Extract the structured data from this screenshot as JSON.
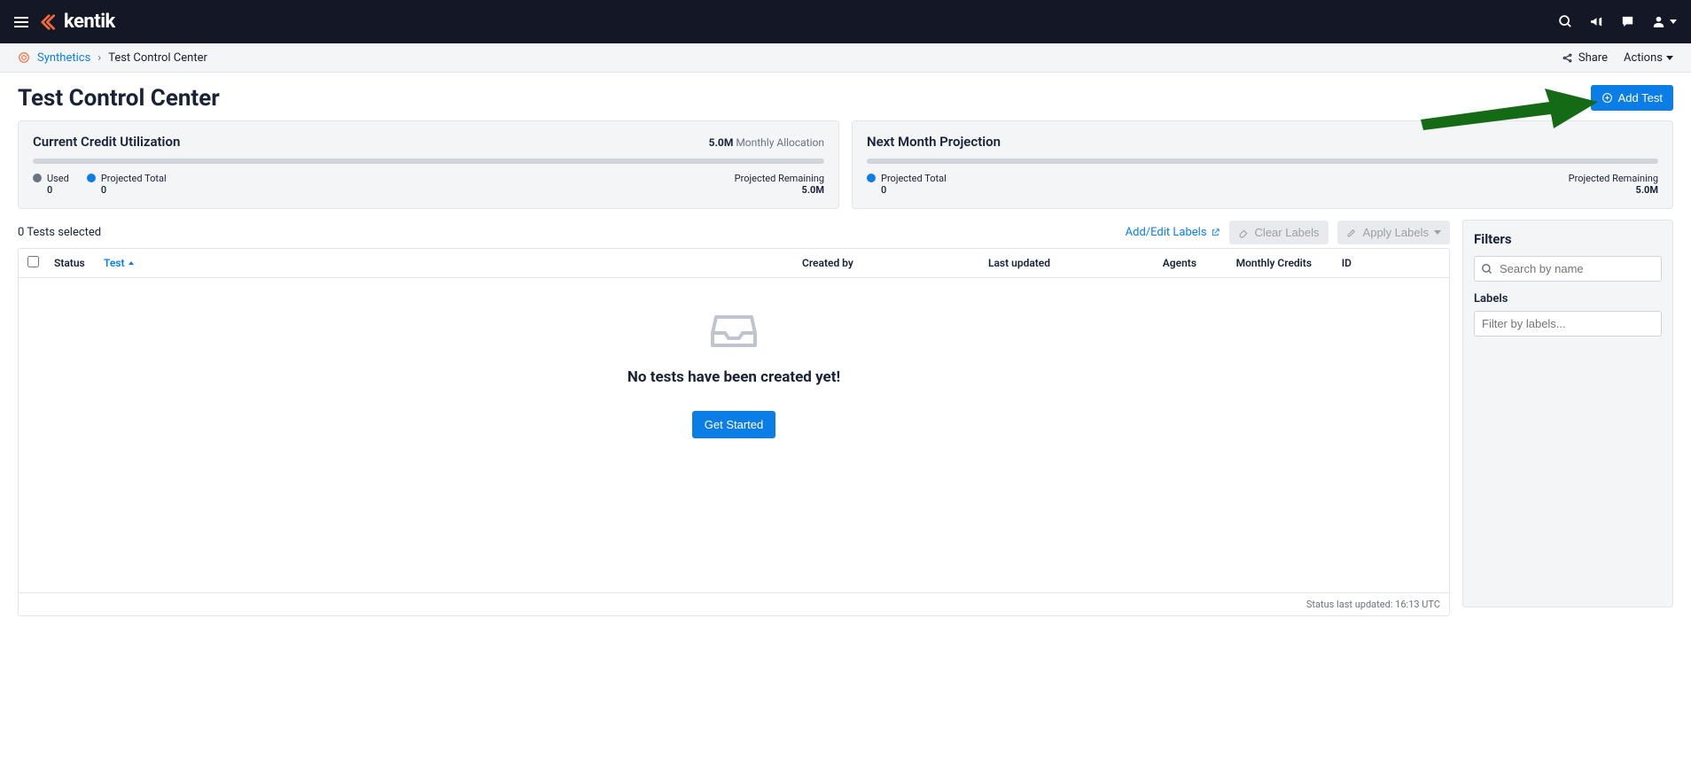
{
  "brand": "kentik",
  "breadcrumb": {
    "root": "Synthetics",
    "current": "Test Control Center"
  },
  "header_actions": {
    "share": "Share",
    "actions": "Actions"
  },
  "page": {
    "title": "Test Control Center",
    "add_test": "Add Test"
  },
  "cards": {
    "current": {
      "title": "Current Credit Utilization",
      "alloc_value": "5.0M",
      "alloc_label": "Monthly Allocation",
      "used_label": "Used",
      "used_value": "0",
      "projected_label": "Projected Total",
      "projected_value": "0",
      "remaining_label": "Projected Remaining",
      "remaining_value": "5.0M"
    },
    "next": {
      "title": "Next Month Projection",
      "projected_label": "Projected Total",
      "projected_value": "0",
      "remaining_label": "Projected Remaining",
      "remaining_value": "5.0M"
    }
  },
  "table": {
    "selected_text": "0 Tests selected",
    "add_edit_labels": "Add/Edit Labels",
    "clear_labels": "Clear Labels",
    "apply_labels": "Apply Labels",
    "columns": {
      "status": "Status",
      "test": "Test",
      "created_by": "Created by",
      "last_updated": "Last updated",
      "agents": "Agents",
      "monthly_credits": "Monthly Credits",
      "id": "ID"
    },
    "empty_title": "No tests have been created yet!",
    "get_started": "Get Started",
    "footer": "Status last updated: 16:13 UTC"
  },
  "filters": {
    "title": "Filters",
    "search_placeholder": "Search by name",
    "labels_label": "Labels",
    "labels_placeholder": "Filter by labels..."
  }
}
